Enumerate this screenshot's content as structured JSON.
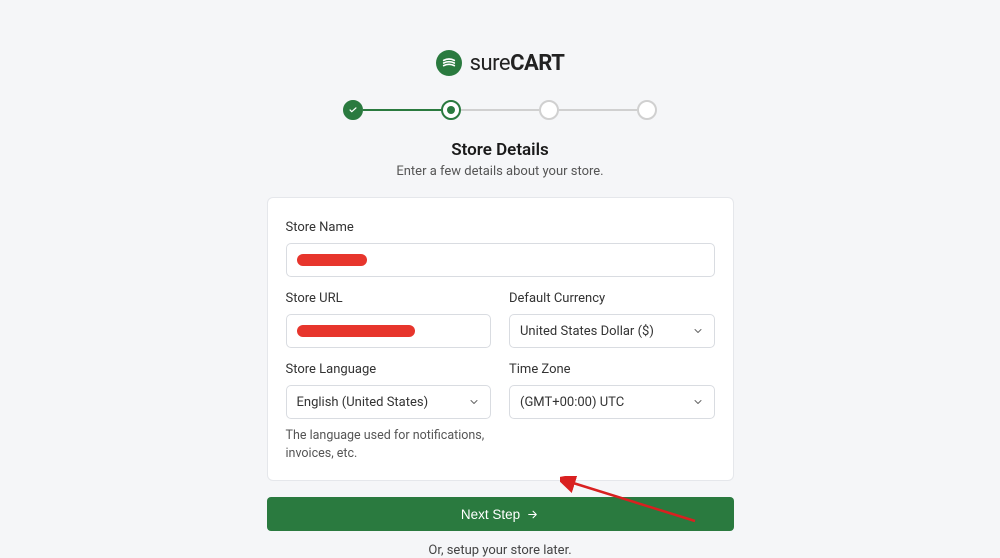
{
  "brand": {
    "name_light": "sure",
    "name_bold": "CART"
  },
  "stepper": {
    "steps": 4,
    "completed": 1,
    "active": 2
  },
  "heading": {
    "title": "Store Details",
    "subtitle": "Enter a few details about your store."
  },
  "form": {
    "store_name": {
      "label": "Store Name"
    },
    "store_url": {
      "label": "Store URL"
    },
    "currency": {
      "label": "Default Currency",
      "value": "United States Dollar ($)"
    },
    "language": {
      "label": "Store Language",
      "value": "English (United States)",
      "helper": "The language used for notifications, invoices, etc."
    },
    "timezone": {
      "label": "Time Zone",
      "value": "(GMT+00:00) UTC"
    }
  },
  "actions": {
    "next": "Next Step",
    "skip": "Or, setup your store later."
  }
}
